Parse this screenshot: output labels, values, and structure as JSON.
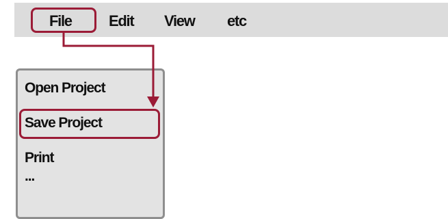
{
  "menubar": {
    "items": [
      {
        "label": "File"
      },
      {
        "label": "Edit"
      },
      {
        "label": "View"
      },
      {
        "label": "etc"
      }
    ]
  },
  "file_menu": {
    "items": [
      {
        "label": "Open Project"
      },
      {
        "label": "Save Project"
      },
      {
        "label": "Print"
      },
      {
        "label": "..."
      }
    ]
  },
  "colors": {
    "highlight": "#9b1b36",
    "menubar_bg": "#dcdcdc",
    "dropdown_bg": "#e3e3e3",
    "dropdown_border": "#8e8e8e"
  }
}
